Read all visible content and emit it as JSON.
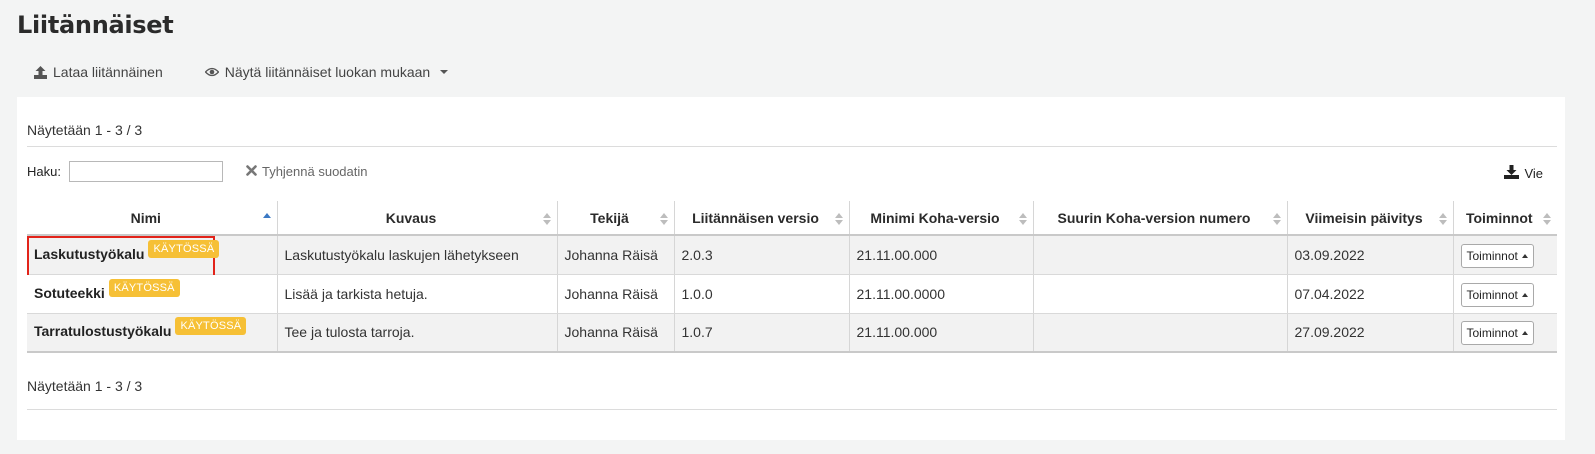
{
  "page": {
    "title": "Liitännäiset"
  },
  "toolbar": {
    "upload_label": "Lataa liitännäinen",
    "upload_icon": "upload-icon",
    "view_by_class_label": "Näytä liitännäiset luokan mukaan",
    "view_icon": "eye-icon"
  },
  "listing": {
    "info_top": "Näytetään 1 - 3 / 3",
    "info_bottom": "Näytetään 1 - 3 / 3",
    "search_label": "Haku:",
    "search_value": "",
    "clear_filter_label": "Tyhjennä suodatin",
    "export_label": "Vie"
  },
  "table": {
    "headers": [
      "Nimi",
      "Kuvaus",
      "Tekijä",
      "Liitännäisen versio",
      "Minimi Koha-versio",
      "Suurin Koha-version numero",
      "Viimeisin päivitys",
      "Toiminnot"
    ],
    "sorted_column": "Nimi",
    "sort_direction": "ascending",
    "rows": [
      {
        "name": "Laskutustyökalu",
        "status": "KÄYTÖSSÄ",
        "description": "Laskutustyökalu laskujen lähetykseen",
        "author": "Johanna Räisä",
        "plugin_version": "2.0.3",
        "min_koha": "21.11.00.000",
        "max_koha": "",
        "updated": "03.09.2022",
        "actions_label": "Toiminnot"
      },
      {
        "name": "Sotuteekki",
        "status": "KÄYTÖSSÄ",
        "description": "Lisää ja tarkista hetuja.",
        "author": "Johanna Räisä",
        "plugin_version": "1.0.0",
        "min_koha": "21.11.00.0000",
        "max_koha": "",
        "updated": "07.04.2022",
        "actions_label": "Toiminnot"
      },
      {
        "name": "Tarratulostustyökalu",
        "status": "KÄYTÖSSÄ",
        "description": "Tee ja tulosta tarroja.",
        "author": "Johanna Räisä",
        "plugin_version": "1.0.7",
        "min_koha": "21.11.00.000",
        "max_koha": "",
        "updated": "27.09.2022",
        "actions_label": "Toiminnot"
      }
    ]
  },
  "colors": {
    "badge": "#f6c036",
    "highlight": "#e2231a",
    "sort_active": "#3b79c4"
  }
}
